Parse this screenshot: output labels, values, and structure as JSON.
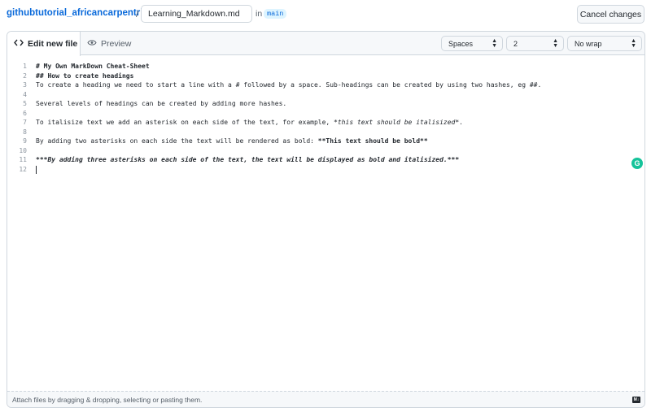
{
  "header": {
    "repo_name": "githubtutorial_africancarpentries",
    "separator": "/",
    "filename_value": "Learning_Markdown.md",
    "in_text": "in",
    "branch": "main",
    "cancel_label": "Cancel changes"
  },
  "tabs": {
    "edit_label": "Edit new file",
    "preview_label": "Preview"
  },
  "settings": {
    "indent_mode": "Spaces",
    "indent_size": "2",
    "wrap_mode": "No wrap"
  },
  "code": {
    "lines": [
      {
        "num": "1",
        "segments": [
          {
            "text": "# My Own MarkDown Cheat-Sheet",
            "style": "b"
          }
        ]
      },
      {
        "num": "2",
        "segments": [
          {
            "text": "## How to create headings",
            "style": "b"
          }
        ]
      },
      {
        "num": "3",
        "segments": [
          {
            "text": "To create a heading we need to start a line with a # followed by a space. Sub-headings can be created by using two hashes, eg ##.",
            "style": ""
          }
        ]
      },
      {
        "num": "4",
        "segments": []
      },
      {
        "num": "5",
        "segments": [
          {
            "text": "Several levels of headings can be created by adding more hashes.",
            "style": ""
          }
        ]
      },
      {
        "num": "6",
        "segments": []
      },
      {
        "num": "7",
        "segments": [
          {
            "text": "To italisize text we add an asterisk on each side of the text, for example, ",
            "style": ""
          },
          {
            "text": "*this text should be italisized*",
            "style": "i"
          },
          {
            "text": ".",
            "style": ""
          }
        ]
      },
      {
        "num": "8",
        "segments": []
      },
      {
        "num": "9",
        "segments": [
          {
            "text": "By adding two asterisks on each side the text will be rendered as bold: ",
            "style": ""
          },
          {
            "text": "**This text should be bold**",
            "style": "b"
          }
        ]
      },
      {
        "num": "10",
        "segments": []
      },
      {
        "num": "11",
        "segments": [
          {
            "text": "***By adding three asterisks on each side of the text, the text will be displayed as bold and italisized.***",
            "style": "b i"
          }
        ]
      },
      {
        "num": "12",
        "segments": []
      }
    ]
  },
  "footer": {
    "attach_text": "Attach files by dragging & dropping, selecting or pasting them.",
    "markdown_icon": "markdown-icon"
  },
  "icons": {
    "code": "code-icon",
    "eye": "eye-icon",
    "grammarly": "grammarly-icon"
  },
  "colors": {
    "link": "#0969da",
    "branch_bg": "#ddf4ff",
    "grammarly": "#15c39a"
  }
}
